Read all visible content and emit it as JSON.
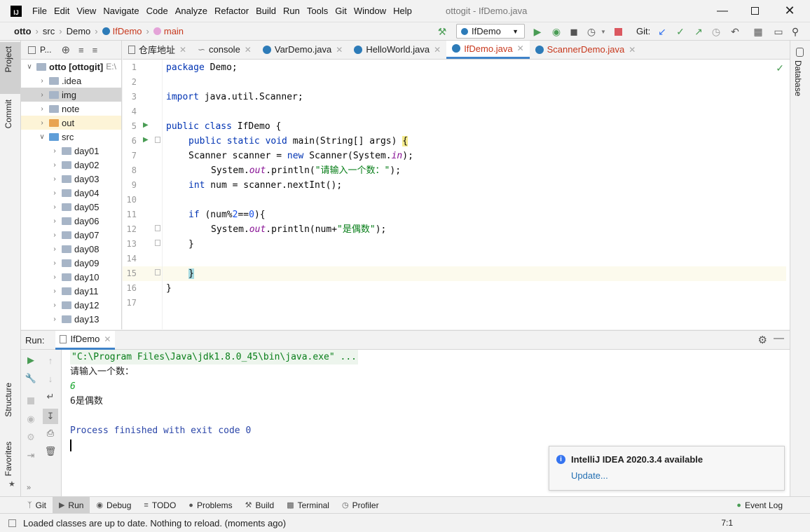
{
  "window": {
    "title": "ottogit - IfDemo.java"
  },
  "menu": [
    "File",
    "Edit",
    "View",
    "Navigate",
    "Code",
    "Analyze",
    "Refactor",
    "Build",
    "Run",
    "Tools",
    "Git",
    "Window",
    "Help"
  ],
  "breadcrumb": {
    "project": "otto",
    "items": [
      "src",
      "Demo",
      "IfDemo",
      "main"
    ]
  },
  "toolbar": {
    "run_config": "IfDemo",
    "git_label": "Git:"
  },
  "left_strip": {
    "project": "Project",
    "commit": "Commit",
    "structure": "Structure",
    "favorites": "Favorites"
  },
  "right_strip": {
    "database": "Database"
  },
  "project_panel": {
    "header": "P...",
    "root": {
      "name": "otto [ottogit]",
      "path": "E:\\"
    },
    "items": [
      ".idea",
      "img",
      "note",
      "out",
      "src"
    ],
    "src_children": [
      "day01",
      "day02",
      "day03",
      "day04",
      "day05",
      "day06",
      "day07",
      "day08",
      "day09",
      "day10",
      "day11",
      "day12",
      "day13"
    ]
  },
  "tabs": [
    {
      "label": "仓库地址"
    },
    {
      "label": "console"
    },
    {
      "label": "VarDemo.java"
    },
    {
      "label": "HelloWorld.java"
    },
    {
      "label": "IfDemo.java"
    },
    {
      "label": "ScannerDemo.java"
    }
  ],
  "code": {
    "line_numbers": [
      "1",
      "2",
      "3",
      "4",
      "5",
      "6",
      "7",
      "8",
      "9",
      "10",
      "11",
      "12",
      "13",
      "14",
      "15",
      "16",
      "17"
    ],
    "l1a": "package",
    "l1b": " Demo;",
    "l3a": "import",
    "l3b": " java.util.Scanner;",
    "l5a": "public class",
    "l5b": " IfDemo {",
    "l6a": "public static void",
    "l6b": " main(String[] args) ",
    "l6c": "{",
    "l7a": "Scanner scanner = ",
    "l7b": "new",
    "l7c": " Scanner(System.",
    "l7d": "in",
    "l7e": ");",
    "l8a": "System.",
    "l8b": "out",
    "l8c": ".println(",
    "l8d": "\"请输入一个数：\"",
    "l8e": ");",
    "l9a": "int",
    "l9b": " num = scanner.nextInt();",
    "l11a": "if",
    "l11b": " (num%",
    "l11c": "2",
    "l11d": "==",
    "l11e": "0",
    "l11f": "){",
    "l12a": "System.",
    "l12b": "out",
    "l12c": ".println(num+",
    "l12d": "\"是偶数\"",
    "l12e": ");",
    "l13": "}",
    "l15": "}",
    "l16": "}"
  },
  "run_panel": {
    "label": "Run:",
    "tab": "IfDemo",
    "console": {
      "cmd": "\"C:\\Program Files\\Java\\jdk1.8.0_45\\bin\\java.exe\" ...",
      "prompt": "请输入一个数：",
      "input": "6",
      "result": "6是偶数",
      "finished": "Process finished with exit code 0"
    }
  },
  "notification": {
    "title": "IntelliJ IDEA 2020.3.4 available",
    "link": "Update..."
  },
  "bottom_tools": [
    "Git",
    "Run",
    "Debug",
    "TODO",
    "Problems",
    "Build",
    "Terminal",
    "Profiler"
  ],
  "event_log": "Event Log",
  "status": {
    "message": "Loaded classes are up to date. Nothing to reload. (moments ago)",
    "position": "7:1"
  },
  "colors": {
    "accent": "#4083c9",
    "run_green": "#499c54",
    "string_green": "#067d17",
    "keyword_blue": "#0033b3"
  }
}
